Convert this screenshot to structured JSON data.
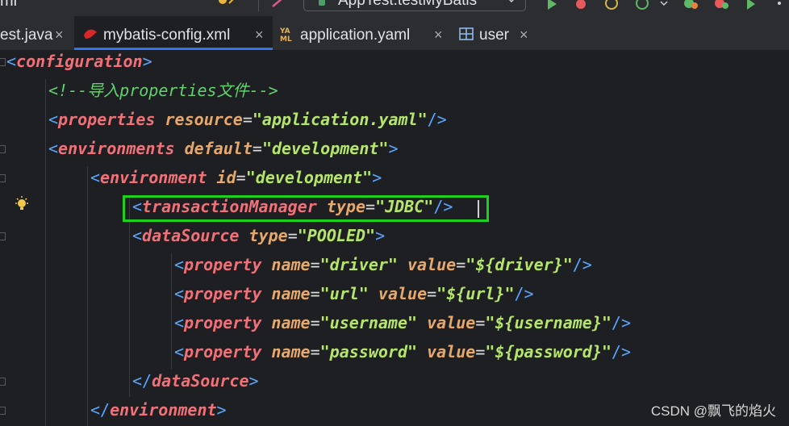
{
  "toolbar": {
    "project_fragment": "mi",
    "run_config": "AppTest.testMyBatis"
  },
  "tabs": [
    {
      "label": "est.java",
      "close": "×",
      "active": false
    },
    {
      "label": "mybatis-config.xml",
      "close": "×",
      "active": true
    },
    {
      "label": "application.yaml",
      "close": "×",
      "active": false
    },
    {
      "label": "user",
      "close": "×",
      "active": false
    }
  ],
  "code": {
    "l1": {
      "open": "<",
      "tag": "configuration",
      "close": ">"
    },
    "l2": {
      "comment": "<!--导入properties文件-->"
    },
    "l3": {
      "open": "<",
      "tag": "properties",
      "attr": "resource",
      "eq": "=",
      "val": "\"application.yaml\"",
      "end": "/>"
    },
    "l4": {
      "open": "<",
      "tag": "environments",
      "attr": "default",
      "eq": "=",
      "val": "\"development\"",
      "close": ">"
    },
    "l5": {
      "open": "<",
      "tag": "environment",
      "attr": "id",
      "eq": "=",
      "val": "\"development\"",
      "close": ">"
    },
    "l6": {
      "open": "<",
      "tag": "transactionManager",
      "attr": "type",
      "eq": "=",
      "val": "\"JDBC\"",
      "end": "/>"
    },
    "l7": {
      "open": "<",
      "tag": "dataSource",
      "attr": "type",
      "eq": "=",
      "val": "\"POOLED\"",
      "close": ">"
    },
    "l8": {
      "open": "<",
      "tag": "property",
      "a1": "name",
      "v1": "\"driver\"",
      "a2": "value",
      "v2": "\"${driver}\"",
      "end": "/>"
    },
    "l9": {
      "open": "<",
      "tag": "property",
      "a1": "name",
      "v1": "\"url\"",
      "a2": "value",
      "v2": "\"${url}\"",
      "end": "/>"
    },
    "l10": {
      "open": "<",
      "tag": "property",
      "a1": "name",
      "v1": "\"username\"",
      "a2": "value",
      "v2": "\"${username}\"",
      "end": "/>"
    },
    "l11": {
      "open": "<",
      "tag": "property",
      "a1": "name",
      "v1": "\"password\"",
      "a2": "value",
      "v2": "\"${password}\"",
      "end": "/>"
    },
    "l12": {
      "open": "</",
      "tag": "dataSource",
      "close": ">"
    },
    "l13": {
      "open": "</",
      "tag": "environment",
      "close": ">"
    }
  },
  "watermark": "CSDN @飘飞的焰火",
  "colors": {
    "highlight_box": "#1ed11e",
    "active_tab_underline": "#3574f0",
    "tag": "#f07178",
    "attribute": "#e6a86b",
    "value": "#b5e56b",
    "comment": "#61d26d"
  }
}
